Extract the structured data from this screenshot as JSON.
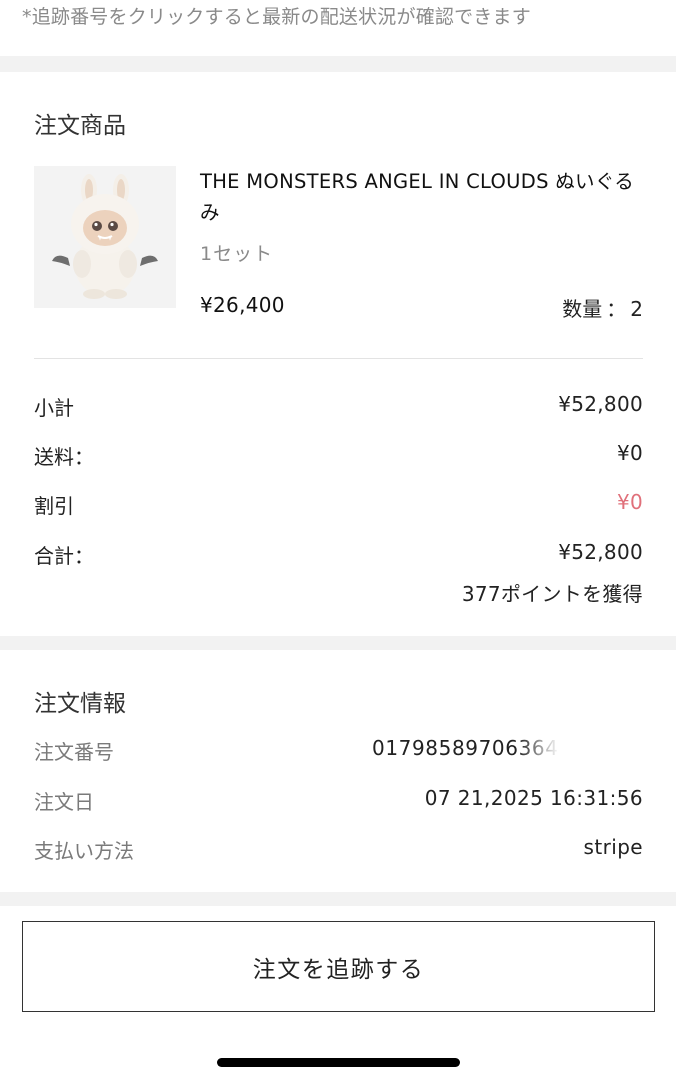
{
  "tracking_note": "*追跡番号をクリックすると最新の配送状況が確認できます",
  "ordered_items": {
    "title": "注文商品",
    "product": {
      "name": "THE MONSTERS ANGEL IN CLOUDS ぬいぐるみ",
      "variant": "1セット",
      "price": "¥26,400",
      "quantity_label": "数量",
      "quantity_separator": "：",
      "quantity": "2",
      "image_icon": "plush-figure-image"
    }
  },
  "summary": {
    "subtotal_label": "小計",
    "subtotal": "¥52,800",
    "shipping_label": "送料：",
    "shipping": "¥0",
    "discount_label": "割引",
    "discount": "¥0",
    "total_label": "合計：",
    "total": "¥52,800",
    "points": "377ポイントを獲得"
  },
  "order_info": {
    "title": "注文情報",
    "order_number_label": "注文番号",
    "order_number": "01798589706364",
    "order_date_label": "注文日",
    "order_date": "07 21,2025 16:31:56",
    "payment_label": "支払い方法",
    "payment": "stripe"
  },
  "track_button": "注文を追跡する",
  "colors": {
    "discount_red": "#e0707a",
    "muted_text": "#8a8a8a",
    "section_gap": "#f2f2f2"
  }
}
